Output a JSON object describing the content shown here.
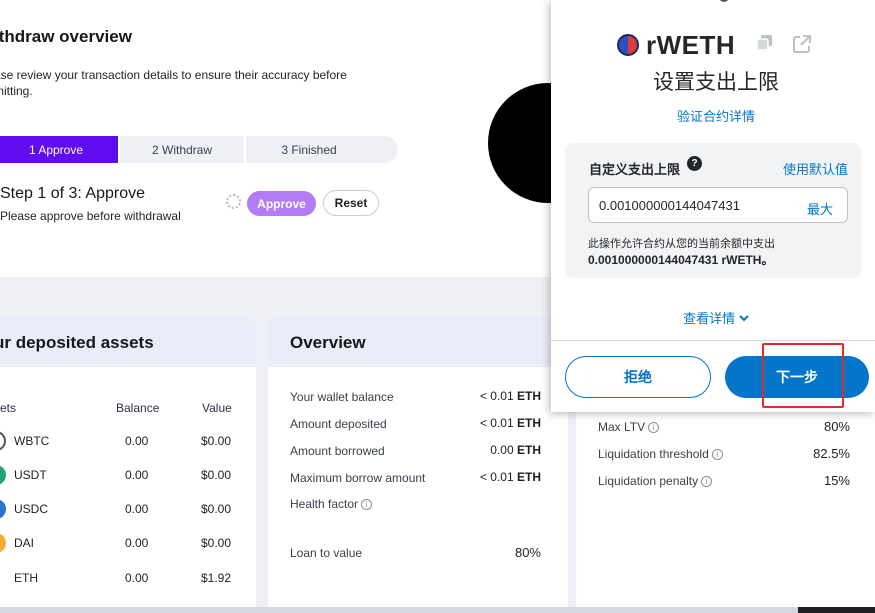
{
  "withdraw": {
    "title": "ithdraw overview",
    "description": "ase review your transaction details to ensure their accuracy before mitting.",
    "steps": [
      "1 Approve",
      "2 Withdraw",
      "3 Finished"
    ],
    "step_title": "Step 1 of 3: Approve",
    "step_subtitle": "Please approve before withdrawal",
    "approve_label": "Approve",
    "reset_label": "Reset"
  },
  "assets": {
    "title": "ur deposited assets",
    "col_asset": "sets",
    "col_balance": "Balance",
    "col_value": "Value",
    "rows": [
      {
        "symbol": "WBTC",
        "balance": "0.00",
        "value": "$0.00",
        "color": "#ffffff"
      },
      {
        "symbol": "USDT",
        "balance": "0.00",
        "value": "$0.00",
        "color": "#26a17b"
      },
      {
        "symbol": "USDC",
        "balance": "0.00",
        "value": "$0.00",
        "color": "#2775ca"
      },
      {
        "symbol": "DAI",
        "balance": "0.00",
        "value": "$0.00",
        "color": "#f5ac37"
      },
      {
        "symbol": "ETH",
        "balance": "0.00",
        "value": "$1.92",
        "color": "#ffffff"
      }
    ]
  },
  "overview": {
    "title": "Overview",
    "rows": [
      {
        "label": "Your wallet balance",
        "amount": "< 0.01",
        "unit": "ETH"
      },
      {
        "label": "Amount deposited",
        "amount": "< 0.01",
        "unit": "ETH"
      },
      {
        "label": "Amount borrowed",
        "amount": "0.00",
        "unit": "ETH"
      },
      {
        "label": "Maximum borrow amount",
        "amount": "< 0.01",
        "unit": "ETH"
      }
    ],
    "health_factor_label": "Health factor",
    "loan_to_value_label": "Loan to value",
    "loan_to_value": "80%"
  },
  "risk": {
    "rows": [
      {
        "label": "Max LTV",
        "value": "80%"
      },
      {
        "label": "Liquidation threshold",
        "value": "82.5%"
      },
      {
        "label": "Liquidation penalty",
        "value": "15%"
      }
    ]
  },
  "popup": {
    "token_name": "rWETH",
    "title": "设置支出上限",
    "verify_link": "验证合约详情",
    "custom_limit_label": "自定义支出上限",
    "use_default": "使用默认值",
    "input_value": "0.001000000144047431",
    "max_label": "最大",
    "note_line1": "此操作允许合约从您的当前余额中支出",
    "note_line2": "0.001000000144047431 rWETH。",
    "view_details": "查看详情",
    "reject_label": "拒绝",
    "next_label": "下一步",
    "accent": "#0376c9",
    "highlight": "#e8262b"
  }
}
